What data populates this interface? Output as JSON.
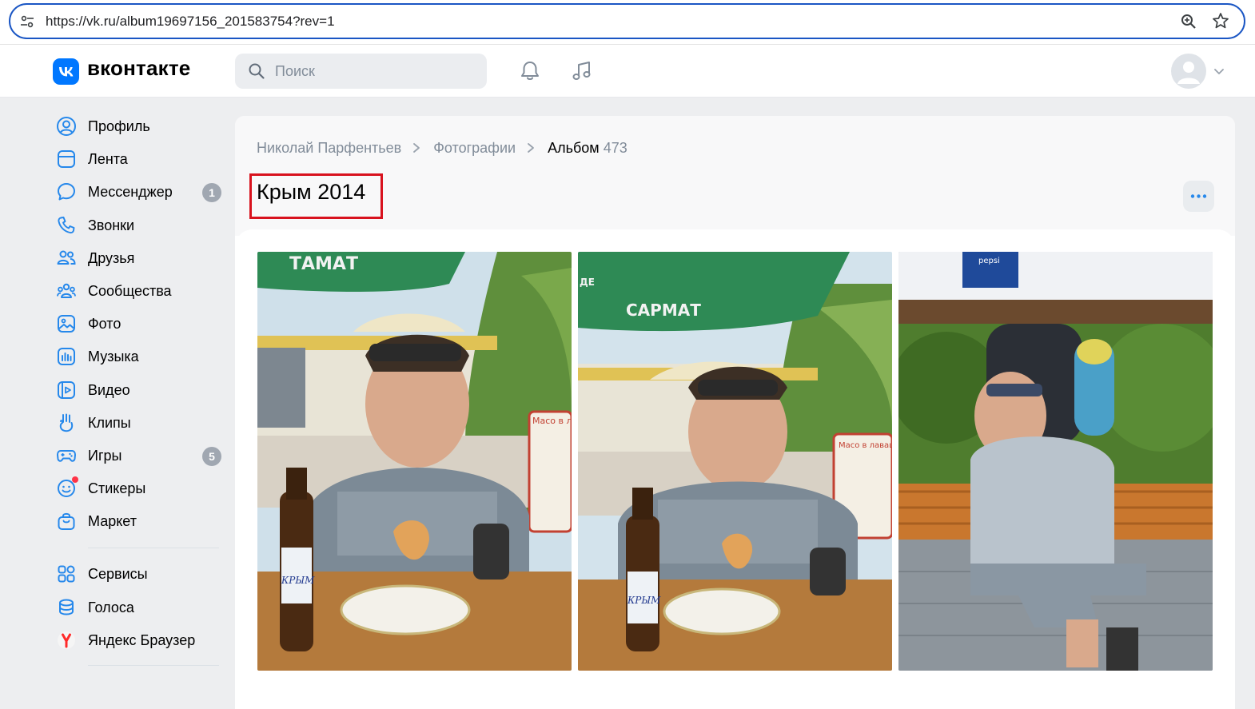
{
  "browser": {
    "url": "https://vk.ru/album19697156_201583754?rev=1"
  },
  "header": {
    "logo_text": "вконтакте",
    "search_placeholder": "Поиск"
  },
  "sidebar": {
    "items": [
      {
        "label": "Профиль",
        "icon": "profile-icon"
      },
      {
        "label": "Лента",
        "icon": "feed-icon"
      },
      {
        "label": "Мессенджер",
        "icon": "messenger-icon",
        "badge": "1"
      },
      {
        "label": "Звонки",
        "icon": "phone-icon"
      },
      {
        "label": "Друзья",
        "icon": "friends-icon"
      },
      {
        "label": "Сообщества",
        "icon": "communities-icon"
      },
      {
        "label": "Фото",
        "icon": "photo-icon"
      },
      {
        "label": "Музыка",
        "icon": "music-icon"
      },
      {
        "label": "Видео",
        "icon": "video-icon"
      },
      {
        "label": "Клипы",
        "icon": "clips-icon"
      },
      {
        "label": "Игры",
        "icon": "games-icon",
        "badge": "5"
      },
      {
        "label": "Стикеры",
        "icon": "stickers-icon"
      },
      {
        "label": "Маркет",
        "icon": "market-icon"
      }
    ],
    "extra_items": [
      {
        "label": "Сервисы",
        "icon": "services-icon"
      },
      {
        "label": "Голоса",
        "icon": "votes-icon"
      },
      {
        "label": "Яндекс Браузер",
        "icon": "yandex-browser-icon"
      }
    ]
  },
  "breadcrumb": {
    "owner": "Николай Парфентьев",
    "section": "Фотографии",
    "current": "Альбом",
    "count": "473"
  },
  "album": {
    "title": "Крым 2014"
  },
  "colors": {
    "accent": "#0077ff",
    "highlight_box": "#d8121e",
    "badge": "#a0a7b1"
  },
  "photos": [
    {
      "name": "photo-man-with-beer-1",
      "printed_text": [
        "ТАМАТ",
        "Масо в лаваш",
        "КРЫМ"
      ]
    },
    {
      "name": "photo-man-with-beer-2",
      "printed_text": [
        "САРМАТ",
        "ДЕ",
        "Масо в лаваше",
        "КРЫМ"
      ]
    },
    {
      "name": "photo-man-with-backpack",
      "printed_text": [
        "pepsi"
      ]
    }
  ]
}
